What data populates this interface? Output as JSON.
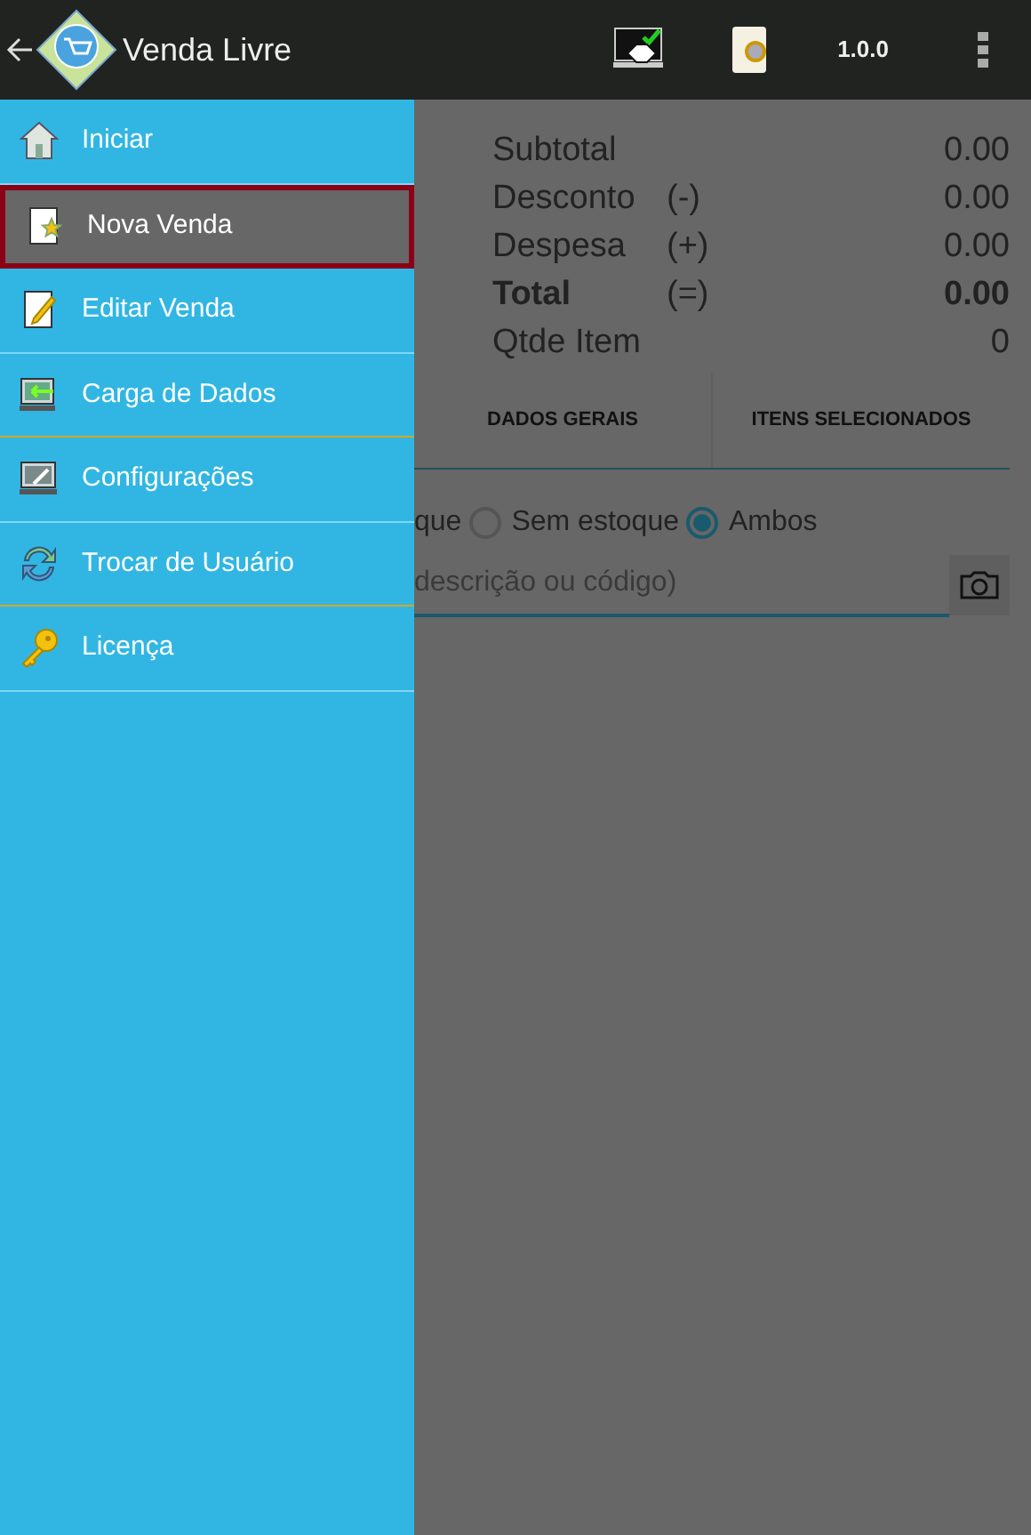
{
  "app_bar": {
    "title": "Venda Livre",
    "version": "1.0.0"
  },
  "drawer": {
    "items": [
      {
        "label": "Iniciar",
        "selected": false,
        "accent_divider": false
      },
      {
        "label": "Nova Venda",
        "selected": true,
        "accent_divider": false
      },
      {
        "label": "Editar Venda",
        "selected": false,
        "accent_divider": false
      },
      {
        "label": "Carga de Dados",
        "selected": false,
        "accent_divider": true
      },
      {
        "label": "Configurações",
        "selected": false,
        "accent_divider": false
      },
      {
        "label": "Trocar de Usuário",
        "selected": false,
        "accent_divider": true
      },
      {
        "label": "Licença",
        "selected": false,
        "accent_divider": false
      }
    ]
  },
  "summary": [
    {
      "label": "Subtotal",
      "value": "0.00",
      "bold": false
    },
    {
      "label": "Desconto",
      "operator": "(-)",
      "value": "0.00",
      "bold": false
    },
    {
      "label": "Despesa",
      "operator": "(+)",
      "value": "0.00",
      "bold": false
    },
    {
      "label": "Total",
      "operator": "(=)",
      "value": "0.00",
      "bold": true
    },
    {
      "label": "Qtde Item",
      "value": "0",
      "bold": false
    }
  ],
  "tabs": [
    {
      "label": "DADOS GERAIS"
    },
    {
      "label": "ITENS SELECIONADOS"
    }
  ],
  "stock_filter": [
    {
      "label": "que"
    },
    {
      "label": "Sem estoque",
      "selected": false
    },
    {
      "label": "Ambos",
      "selected": true
    }
  ],
  "search": {
    "placeholder": "descrição ou código)"
  }
}
